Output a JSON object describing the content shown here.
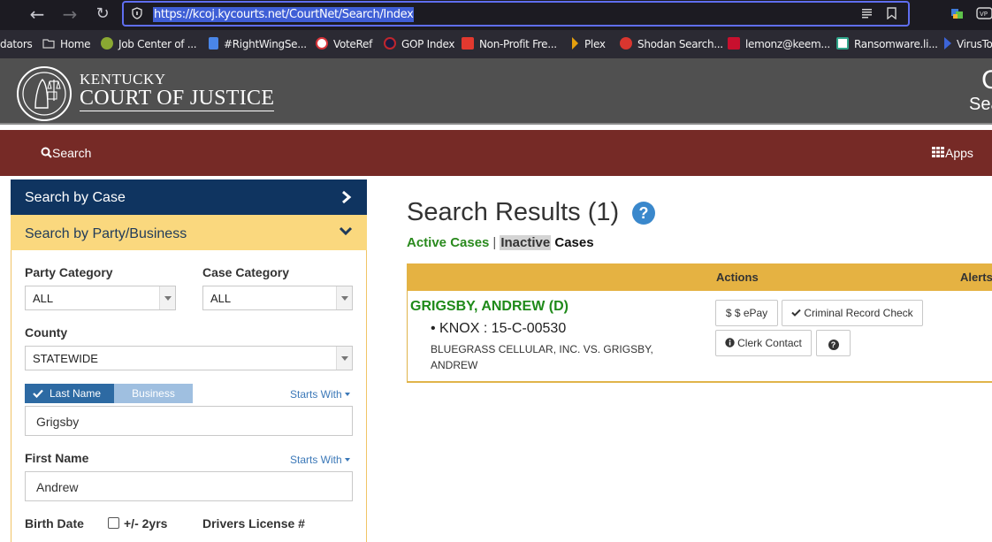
{
  "browser": {
    "url": "https://kcoj.kycourts.net/CourtNet/Search/Index",
    "nav": {
      "back": "←",
      "forward": "→",
      "reload": "↻"
    }
  },
  "bookmarks": [
    {
      "label": "dators",
      "icon": "none",
      "color": ""
    },
    {
      "label": "Home",
      "icon": "folder-icon",
      "color": "#cfcfcf"
    },
    {
      "label": "Job Center of ...",
      "icon": "badge-icon",
      "color": "#8aa832"
    },
    {
      "label": "#RightWingSe...",
      "icon": "doc-icon",
      "color": "#4a86e8"
    },
    {
      "label": "VoteRef",
      "icon": "check-circle-icon",
      "color": "#d8343a"
    },
    {
      "label": "GOP Index",
      "icon": "elephant-icon",
      "color": "#c0262d"
    },
    {
      "label": "Non-Profit Fre...",
      "icon": "pdf-icon",
      "color": "#e2392f"
    },
    {
      "label": "Plex",
      "icon": "plex-icon",
      "color": "#e5a00d"
    },
    {
      "label": "Shodan Search...",
      "icon": "shodan-icon",
      "color": "#d9362f"
    },
    {
      "label": "lemonz@keem...",
      "icon": "mail-icon",
      "color": "#c8102e"
    },
    {
      "label": "Ransomware.li...",
      "icon": "ransom-icon",
      "color": "#2fa58a"
    },
    {
      "label": "VirusTo",
      "icon": "virustotal-icon",
      "color": "#3c64d8"
    }
  ],
  "site": {
    "brand_top": "KENTUCKY",
    "brand_main": "COURT OF JUSTICE",
    "header_right_1": "C",
    "header_right_2": "Sea",
    "nav_search": "Search",
    "nav_apps": "Apps"
  },
  "sidebar": {
    "search_by_case": "Search by Case",
    "search_by_party": "Search by Party/Business",
    "party_category_label": "Party Category",
    "party_category_value": "ALL",
    "case_category_label": "Case Category",
    "case_category_value": "ALL",
    "county_label": "County",
    "county_value": "STATEWIDE",
    "toggle_last_name": "Last Name",
    "toggle_business": "Business",
    "starts_with": "Starts With",
    "last_name_value": "Grigsby",
    "first_name_label": "First Name",
    "first_name_value": "Andrew",
    "birth_date_label": "Birth Date",
    "plus_minus_label": "+/- 2yrs",
    "drivers_license_label": "Drivers License #"
  },
  "results": {
    "title": "Search Results (1)",
    "tab_active": "Active Cases",
    "tab_separator": "|",
    "tab_inactive_hl": "Inactive",
    "tab_inactive_rest": " Cases",
    "col_actions": "Actions",
    "col_alerts": "Alerts",
    "row": {
      "party": "GRIGSBY, ANDREW (D)",
      "case_number": "• KNOX : 15-C-00530",
      "case_title": "BLUEGRASS CELLULAR, INC. VS. GRIGSBY, ANDREW",
      "btn_epay": "$ $ ePay",
      "btn_criminal": "Criminal Record Check",
      "btn_clerk": "Clerk Contact",
      "btn_help": "?"
    }
  },
  "colors": {
    "nav_bar": "#762a26",
    "case_tab": "#0f3460",
    "party_tab": "#fad87e",
    "table_header": "#e5b242",
    "party_green": "#1f8a1a"
  }
}
